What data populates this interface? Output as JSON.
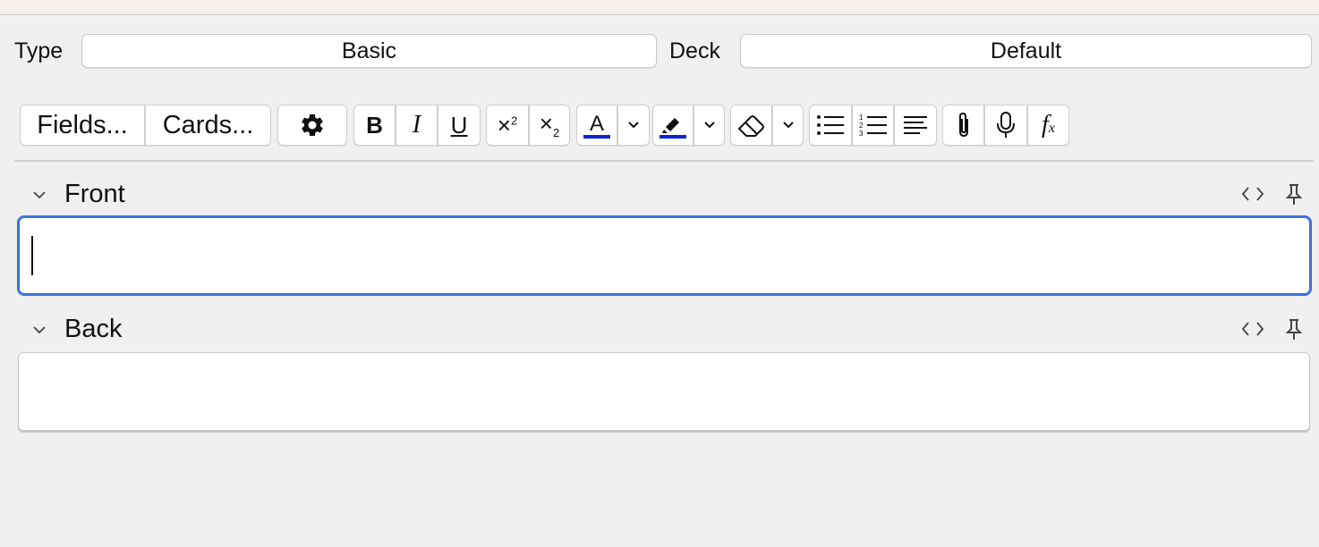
{
  "header": {
    "type_label": "Type",
    "type_value": "Basic",
    "deck_label": "Deck",
    "deck_value": "Default"
  },
  "toolbar": {
    "fields_label": "Fields...",
    "cards_label": "Cards...",
    "buttons": [
      "settings-icon",
      "bold-icon",
      "italic-icon",
      "underline-icon",
      "superscript-icon",
      "subscript-icon",
      "text-color-icon",
      "highlight-color-icon",
      "eraser-icon",
      "unordered-list-icon",
      "ordered-list-icon",
      "align-icon",
      "attachment-icon",
      "microphone-icon",
      "function-icon"
    ],
    "text_color": "#0a24d6",
    "highlight_color": "#0a24d6"
  },
  "fields": [
    {
      "label": "Front",
      "value": ""
    },
    {
      "label": "Back",
      "value": ""
    }
  ],
  "colors": {
    "focus_border": "#3a72e0",
    "background": "#f0f0f0"
  }
}
